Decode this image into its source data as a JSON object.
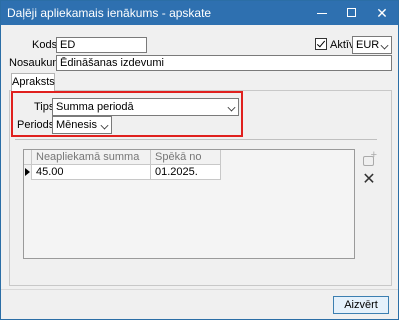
{
  "window": {
    "title": "Daļēji apliekamais ienākums - apskate"
  },
  "form": {
    "kods_label": "Kods",
    "kods_value": "ED",
    "aktivs_label": "Aktīvs",
    "aktivs_checked": true,
    "currency_value": "EUR",
    "nosaukums_label": "Nosaukums",
    "nosaukums_value": "Ēdināšanas izdevumi"
  },
  "tabs": [
    {
      "label": "Apraksts",
      "active": true
    }
  ],
  "panel": {
    "tips_label": "Tips",
    "tips_value": "Summa periodā",
    "periods_label": "Periods",
    "periods_value": "Mēnesis",
    "highlight_color": "#e0201e"
  },
  "grid": {
    "columns": [
      "Neapliekamā summa",
      "Spēkā no"
    ],
    "rows": [
      {
        "summa": "45.00",
        "speka_no": "01.2025."
      }
    ]
  },
  "footer": {
    "close_label": "Aizvērt"
  },
  "colors": {
    "titlebar": "#2e70b0",
    "window_bg": "#f0f0f0"
  },
  "icons": {
    "add": "add-row-icon",
    "delete": "delete-icon"
  }
}
